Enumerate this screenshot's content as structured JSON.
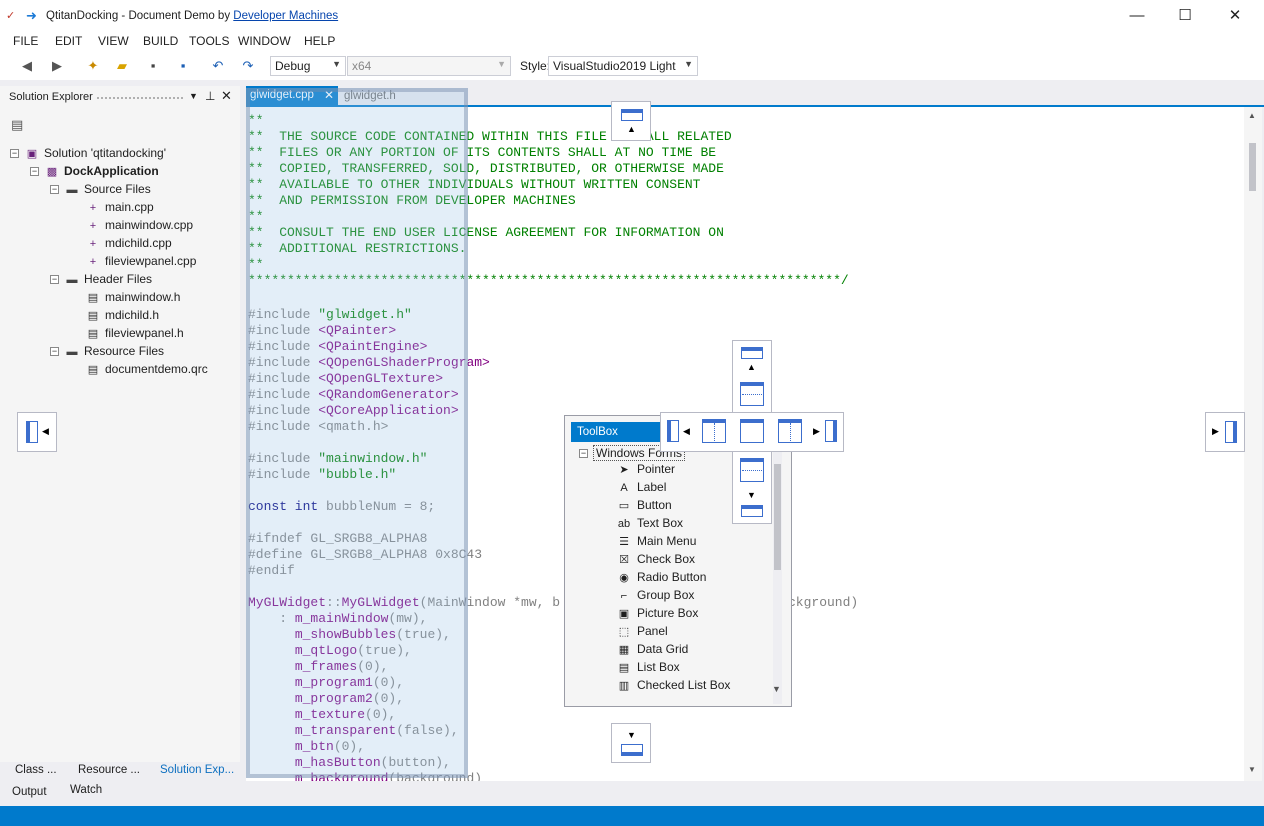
{
  "window": {
    "title_prefix": "QtitanDocking - Document Demo by ",
    "title_link": "Developer Machines",
    "minimize": "—",
    "maximize": "☐",
    "close": "✕"
  },
  "menu": [
    "FILE",
    "EDIT",
    "VIEW",
    "BUILD",
    "TOOLS",
    "WINDOW",
    "HELP"
  ],
  "toolbar": {
    "config": "Debug",
    "platform": "x64",
    "style_label": "Style:",
    "style_value": "VisualStudio2019 Light"
  },
  "solution_explorer": {
    "title": "Solution Explorer",
    "tree": [
      {
        "label": "Solution 'qtitandocking'",
        "icon": "solution-icon",
        "expanded": true,
        "bold": false
      },
      {
        "label": "DockApplication",
        "icon": "project-icon",
        "expanded": true,
        "bold": true
      },
      {
        "label": "Source Files",
        "icon": "folder-icon",
        "expanded": true,
        "bold": false
      },
      {
        "label": "main.cpp",
        "icon": "cpp-file-icon"
      },
      {
        "label": "mainwindow.cpp",
        "icon": "cpp-file-icon"
      },
      {
        "label": "mdichild.cpp",
        "icon": "cpp-file-icon"
      },
      {
        "label": "fileviewpanel.cpp",
        "icon": "cpp-file-icon"
      },
      {
        "label": "Header Files",
        "icon": "folder-icon",
        "expanded": true,
        "bold": false
      },
      {
        "label": "mainwindow.h",
        "icon": "header-file-icon"
      },
      {
        "label": "mdichild.h",
        "icon": "header-file-icon"
      },
      {
        "label": "fileviewpanel.h",
        "icon": "header-file-icon"
      },
      {
        "label": "Resource Files",
        "icon": "folder-icon",
        "expanded": true,
        "bold": false
      },
      {
        "label": "documentdemo.qrc",
        "icon": "resource-file-icon"
      }
    ],
    "bottom_tabs": [
      "Class ...",
      "Resource ...",
      "Solution Exp..."
    ]
  },
  "output_tabs": [
    "Output",
    "Watch"
  ],
  "document_tabs": [
    {
      "label": "glwidget.cpp",
      "active": true
    },
    {
      "label": "glwidget.h",
      "active": false
    }
  ],
  "code": {
    "comment_lines": [
      "**",
      "**  THE SOURCE CODE CONTAINED WITHIN THIS FILE AND ALL RELATED",
      "**  FILES OR ANY PORTION OF ITS CONTENTS SHALL AT NO TIME BE",
      "**  COPIED, TRANSFERRED, SOLD, DISTRIBUTED, OR OTHERWISE MADE",
      "**  AVAILABLE TO OTHER INDIVIDUALS WITHOUT WRITTEN CONSENT",
      "**  AND PERMISSION FROM DEVELOPER MACHINES",
      "**",
      "**  CONSULT THE END USER LICENSE AGREEMENT FOR INFORMATION ON",
      "**  ADDITIONAL RESTRICTIONS.",
      "**",
      "****************************************************************************/"
    ],
    "includes": [
      {
        "pre": "#include ",
        "arg": "\"glwidget.h\"",
        "kind": "str"
      },
      {
        "pre": "#include ",
        "arg": "<QPainter>",
        "kind": "cls"
      },
      {
        "pre": "#include ",
        "arg": "<QPaintEngine>",
        "kind": "cls"
      },
      {
        "pre": "#include ",
        "arg": "<QOpenGLShaderProgram>",
        "kind": "cls"
      },
      {
        "pre": "#include ",
        "arg": "<QOpenGLTexture>",
        "kind": "cls"
      },
      {
        "pre": "#include ",
        "arg": "<QRandomGenerator>",
        "kind": "cls"
      },
      {
        "pre": "#include ",
        "arg": "<QCoreApplication>",
        "kind": "cls"
      },
      {
        "pre": "#include ",
        "arg": "<qmath.h>",
        "kind": "pp"
      }
    ],
    "includes2": [
      {
        "pre": "#include ",
        "arg": "\"mainwindow.h\"",
        "kind": "str"
      },
      {
        "pre": "#include ",
        "arg": "\"bubble.h\"",
        "kind": "str"
      }
    ],
    "const_line": {
      "kw": "const int ",
      "rest": "bubbleNum = 8;"
    },
    "ifdef_lines": [
      "#ifndef GL_SRGB8_ALPHA8",
      "#define GL_SRGB8_ALPHA8 0x8C43",
      "#endif"
    ],
    "ctor": {
      "a": "MyGLWidget",
      "b": "::",
      "c": "MyGLWidget",
      "d": "(MainWindow *mw, b",
      "e": "ckground)"
    },
    "init_list": [
      {
        "p": "    : ",
        "m": "m_mainWindow",
        "a": "(mw),"
      },
      {
        "p": "      ",
        "m": "m_showBubbles",
        "a": "(true),"
      },
      {
        "p": "      ",
        "m": "m_qtLogo",
        "a": "(true),"
      },
      {
        "p": "      ",
        "m": "m_frames",
        "a": "(0),"
      },
      {
        "p": "      ",
        "m": "m_program1",
        "a": "(0),"
      },
      {
        "p": "      ",
        "m": "m_program2",
        "a": "(0),"
      },
      {
        "p": "      ",
        "m": "m_texture",
        "a": "(0),"
      },
      {
        "p": "      ",
        "m": "m_transparent",
        "a": "(false),"
      },
      {
        "p": "      ",
        "m": "m_btn",
        "a": "(0),"
      },
      {
        "p": "      ",
        "m": "m_hasButton",
        "a": "(button),"
      },
      {
        "p": "      ",
        "m": "m_background",
        "a": "(background)"
      }
    ]
  },
  "toolbox": {
    "title": "ToolBox",
    "group": "Windows Forms",
    "items": [
      {
        "label": "Pointer",
        "icon": "pointer-icon",
        "glyph": "➤"
      },
      {
        "label": "Label",
        "icon": "label-icon",
        "glyph": "A"
      },
      {
        "label": "Button",
        "icon": "button-icon",
        "glyph": "▭"
      },
      {
        "label": "Text Box",
        "icon": "textbox-icon",
        "glyph": "ab"
      },
      {
        "label": "Main Menu",
        "icon": "main-menu-icon",
        "glyph": "☰"
      },
      {
        "label": "Check Box",
        "icon": "checkbox-icon",
        "glyph": "☒"
      },
      {
        "label": "Radio Button",
        "icon": "radio-button-icon",
        "glyph": "◉"
      },
      {
        "label": "Group Box",
        "icon": "group-box-icon",
        "glyph": "⌐"
      },
      {
        "label": "Picture Box",
        "icon": "picture-box-icon",
        "glyph": "▣"
      },
      {
        "label": "Panel",
        "icon": "panel-icon",
        "glyph": "⬚"
      },
      {
        "label": "Data Grid",
        "icon": "data-grid-icon",
        "glyph": "▦"
      },
      {
        "label": "List Box",
        "icon": "list-box-icon",
        "glyph": "▤"
      },
      {
        "label": "Checked List Box",
        "icon": "checked-list-box-icon",
        "glyph": "▥"
      }
    ]
  },
  "colors": {
    "accent": "#007acc",
    "dock_guide": "#3c6ecd",
    "comment": "#008000",
    "preprocessor": "#808080",
    "keyword": "#000080",
    "class": "#800080",
    "member": "#800000"
  }
}
